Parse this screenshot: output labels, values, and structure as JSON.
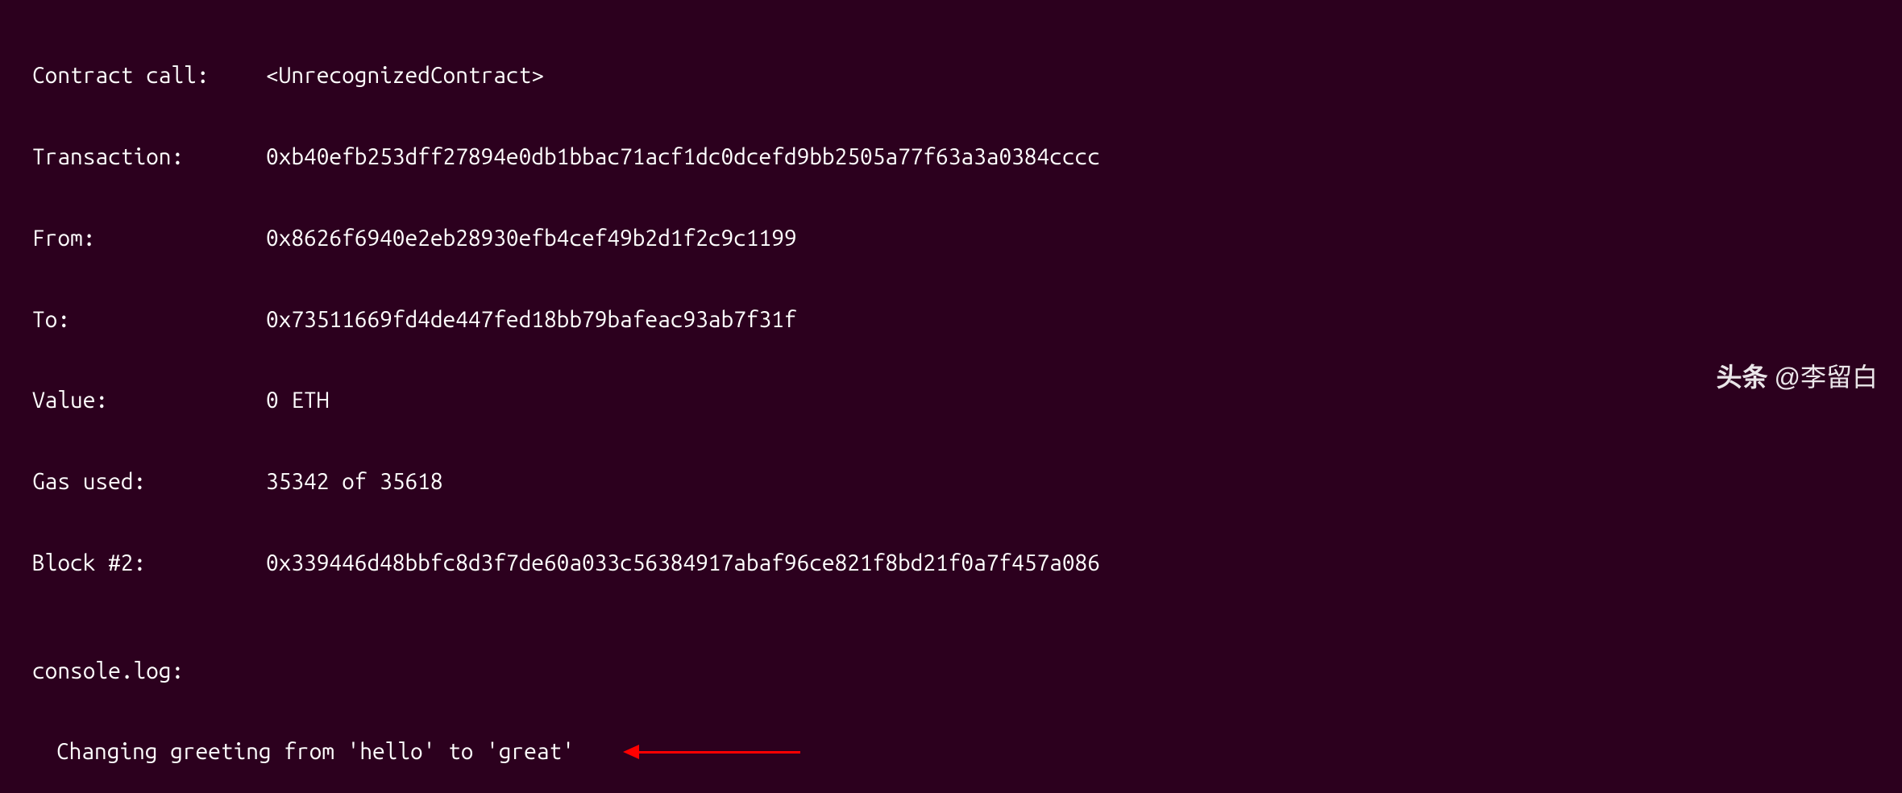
{
  "terminal": {
    "contractCall": {
      "label": "Contract call:",
      "value": "<UnrecognizedContract>"
    },
    "transaction": {
      "label": "Transaction:",
      "value": "0xb40efb253dff27894e0db1bbac71acf1dc0dcefd9bb2505a77f63a3a0384cccc"
    },
    "from": {
      "label": "From:",
      "value": "0x8626f6940e2eb28930efb4cef49b2d1f2c9c1199"
    },
    "to": {
      "label": "To:",
      "value": "0x73511669fd4de447fed18bb79bafeac93ab7f31f"
    },
    "valueField": {
      "label": "Value:",
      "value": "0 ETH"
    },
    "gasUsed": {
      "label": "Gas used:",
      "value": "35342 of 35618"
    },
    "block": {
      "label": "Block #2:",
      "value": "0x339446d48bbfc8d3f7de60a033c56384917abaf96ce821f8bd21f0a7f457a086"
    },
    "consoleLogLabel": "console.log:",
    "consoleLogMessage": "Changing greeting from 'hello' to 'great'"
  },
  "watermark": {
    "prefix": "头条",
    "author": "@李留白"
  }
}
